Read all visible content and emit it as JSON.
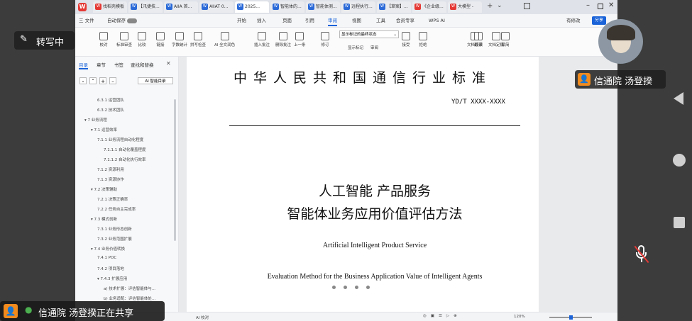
{
  "tabs": [
    {
      "label": "找稻壳模板",
      "color": "#e53935"
    },
    {
      "label": "【汛捷技...",
      "color": "#2b6ad8"
    },
    {
      "label": "AIIA 首...",
      "color": "#2b6ad8"
    },
    {
      "label": "AIIAT 0...",
      "color": "#2b6ad8"
    },
    {
      "label": "2025...",
      "color": "#2b6ad8"
    },
    {
      "label": "智能体的...",
      "color": "#2b6ad8"
    },
    {
      "label": "智能体测...",
      "color": "#2b6ad8"
    },
    {
      "label": "远程执行...",
      "color": "#2b6ad8"
    },
    {
      "label": "【草案】...",
      "color": "#2b6ad8"
    },
    {
      "label": "《企业级...",
      "color": "#e53935"
    },
    {
      "label": "大模型 -",
      "color": "#e53935"
    }
  ],
  "menus": [
    "三 文件",
    "自动保存",
    "开始",
    "插入",
    "页面",
    "引用",
    "审阅",
    "视图",
    "工具",
    "会员专享",
    "WPS AI"
  ],
  "menu_active": "审阅",
  "menu_right": [
    "有修改",
    "分享"
  ],
  "ribbon": [
    "校对",
    "标准审查",
    "比较",
    "链接",
    "字数统计",
    "拼写检查",
    "AI 全文润色",
    "插入批注",
    "删除批注",
    "上一条",
    "下一条",
    "修订",
    "显示标记",
    "审阅",
    "接受",
    "拒绝",
    "上一条",
    "限制编辑",
    "文档权限",
    "文档定稿",
    "翻译",
    "繁简"
  ],
  "ribbon_select": "显示标记的最终状态",
  "nav": {
    "tabs": [
      "目录",
      "章节",
      "书签",
      "查找和替换"
    ],
    "ai_button": "AI 智能目录",
    "items": [
      {
        "text": "6.3.1 运营团队",
        "level": 3
      },
      {
        "text": "6.3.2 技术团队",
        "level": 3
      },
      {
        "text": "7 业务流程",
        "level": 1
      },
      {
        "text": "7.1 运营效率",
        "level": 2
      },
      {
        "text": "7.1.1 业务流程自动化程度",
        "level": 3
      },
      {
        "text": "7.1.1.1 自动化覆盖程度",
        "level": 4
      },
      {
        "text": "7.1.1.2 自动化执行效率",
        "level": 4
      },
      {
        "text": "7.1.2 资源利用",
        "level": 3
      },
      {
        "text": "7.1.3 资源协作",
        "level": 3
      },
      {
        "text": "7.2 决策辅助",
        "level": 2
      },
      {
        "text": "7.2.1 决策正确率",
        "level": 3
      },
      {
        "text": "7.2.2 任务自主完成率",
        "level": 3
      },
      {
        "text": "7.3 模式创新",
        "level": 2
      },
      {
        "text": "7.3.1 业务形态创新",
        "level": 3
      },
      {
        "text": "7.3.2 业务范围扩展",
        "level": 3
      },
      {
        "text": "7.4 业务价值转换",
        "level": 2
      },
      {
        "text": "7.4.1 POC",
        "level": 3
      },
      {
        "text": "7.4.2 项目落地",
        "level": 3
      },
      {
        "text": "7.4.3 扩展应用",
        "level": 3
      },
      {
        "text": "a) 技术扩展：评估智能体与...",
        "level": 4
      },
      {
        "text": "b) 业务适配：评估智能体处...",
        "level": 4
      }
    ]
  },
  "doc": {
    "header": "中华人民共和国通信行业标准",
    "code": "YD/T XXXX-XXXX",
    "title1": "人工智能 产品服务",
    "title2": "智能体业务应用价值评估方法",
    "en1": "Artificial Intelligent Product Service",
    "en2": "Evaluation Method for the Business Application Value of Intelligent Agents"
  },
  "status": {
    "left": "AI 校对",
    "zoom": "120%"
  },
  "overlay": {
    "transcribing": "转写中",
    "speaker": "信通院 汤登揆",
    "sharing": "信通院 汤登揆正在共享"
  },
  "colors": {
    "accent": "#1a63d8",
    "speaker_bg": "#f28b1e",
    "share_bg": "#f28b1e"
  }
}
